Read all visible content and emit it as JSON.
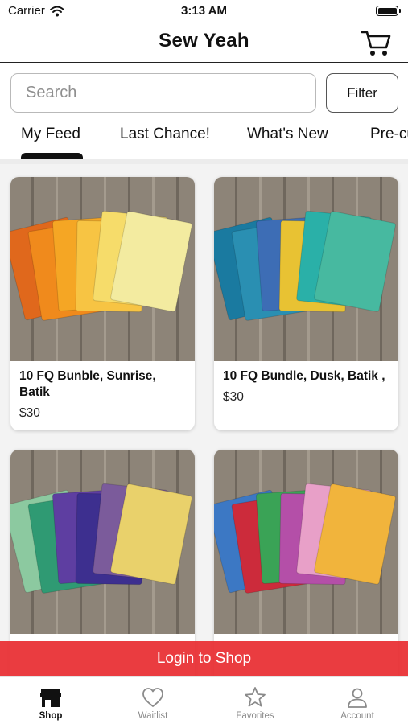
{
  "status_bar": {
    "carrier": "Carrier",
    "time": "3:13 AM"
  },
  "header": {
    "title": "Sew Yeah",
    "cart_icon": "shopping-cart-icon"
  },
  "search": {
    "placeholder": "Search",
    "value": "",
    "filter_label": "Filter"
  },
  "tabs": [
    {
      "label": "My Feed",
      "active": true
    },
    {
      "label": "Last Chance!",
      "active": false
    },
    {
      "label": "What's New",
      "active": false
    },
    {
      "label": "Pre-cu",
      "active": false
    }
  ],
  "products": [
    {
      "title": "10 FQ Bunble, Sunrise, Batik",
      "price": "$30",
      "palette": [
        "#e0681c",
        "#f08a1c",
        "#f5a624",
        "#f7c443",
        "#f6dc6a",
        "#f3eba0"
      ]
    },
    {
      "title": "10 FQ Bundle,  Dusk, Batik ,",
      "price": "$30",
      "palette": [
        "#1a7aa0",
        "#2a8fb2",
        "#3d6db5",
        "#e8c233",
        "#2ab0a8",
        "#47b9a0"
      ]
    },
    {
      "title": "",
      "price": "",
      "palette": [
        "#8cc9a0",
        "#2f9a73",
        "#5e3ea1",
        "#3d2f8f",
        "#7b5b9b",
        "#e9d16b"
      ]
    },
    {
      "title": "",
      "price": "",
      "palette": [
        "#3c78c4",
        "#cc2b3b",
        "#3aa356",
        "#b44fa8",
        "#e8a0c8",
        "#f1b43c"
      ]
    }
  ],
  "login_banner": "Login to Shop",
  "tab_bar": [
    {
      "label": "Shop",
      "icon": "storefront-icon",
      "active": true
    },
    {
      "label": "Waitlist",
      "icon": "heart-icon",
      "active": false
    },
    {
      "label": "Favorites",
      "icon": "star-icon",
      "active": false
    },
    {
      "label": "Account",
      "icon": "person-icon",
      "active": false
    }
  ],
  "colors": {
    "accent_red": "#e82d32",
    "text": "#111111",
    "inactive": "#8a8a8a"
  }
}
